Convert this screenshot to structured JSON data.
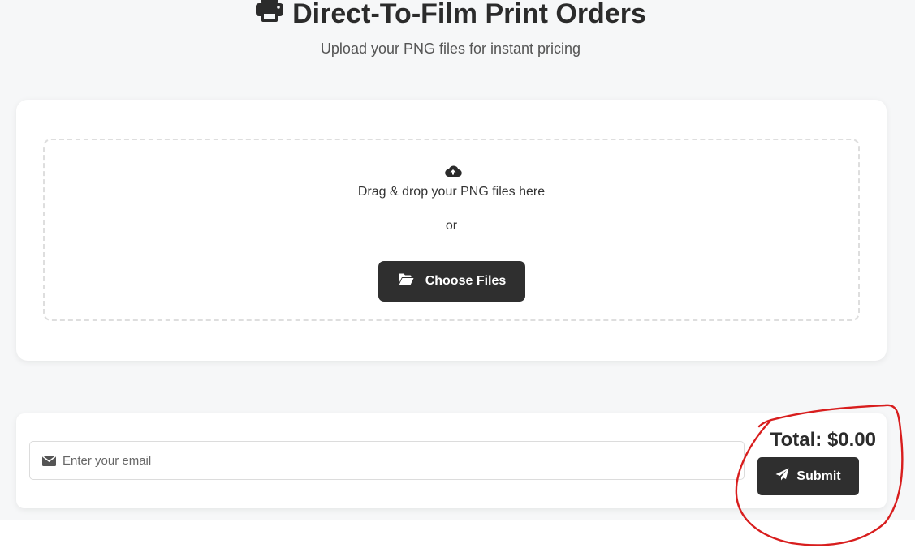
{
  "header": {
    "title": "Direct-To-Film Print Orders",
    "subtitle": "Upload your PNG files for instant pricing",
    "icon": "printer-icon"
  },
  "upload": {
    "icon": "cloud-upload-icon",
    "drop_text": "Drag & drop your PNG files here",
    "or_text": "or",
    "choose_button_label": "Choose Files",
    "choose_button_icon": "folder-open-icon"
  },
  "order": {
    "email_placeholder": "Enter your email",
    "email_value": "",
    "email_icon": "envelope-icon",
    "total_label": "Total: $0.00",
    "submit_label": "Submit",
    "submit_icon": "paper-plane-icon"
  },
  "colors": {
    "page_background": "#f6f7f8",
    "card_background": "#ffffff",
    "button_background": "#2f2f2f",
    "annotation_red": "#d81e1e"
  }
}
